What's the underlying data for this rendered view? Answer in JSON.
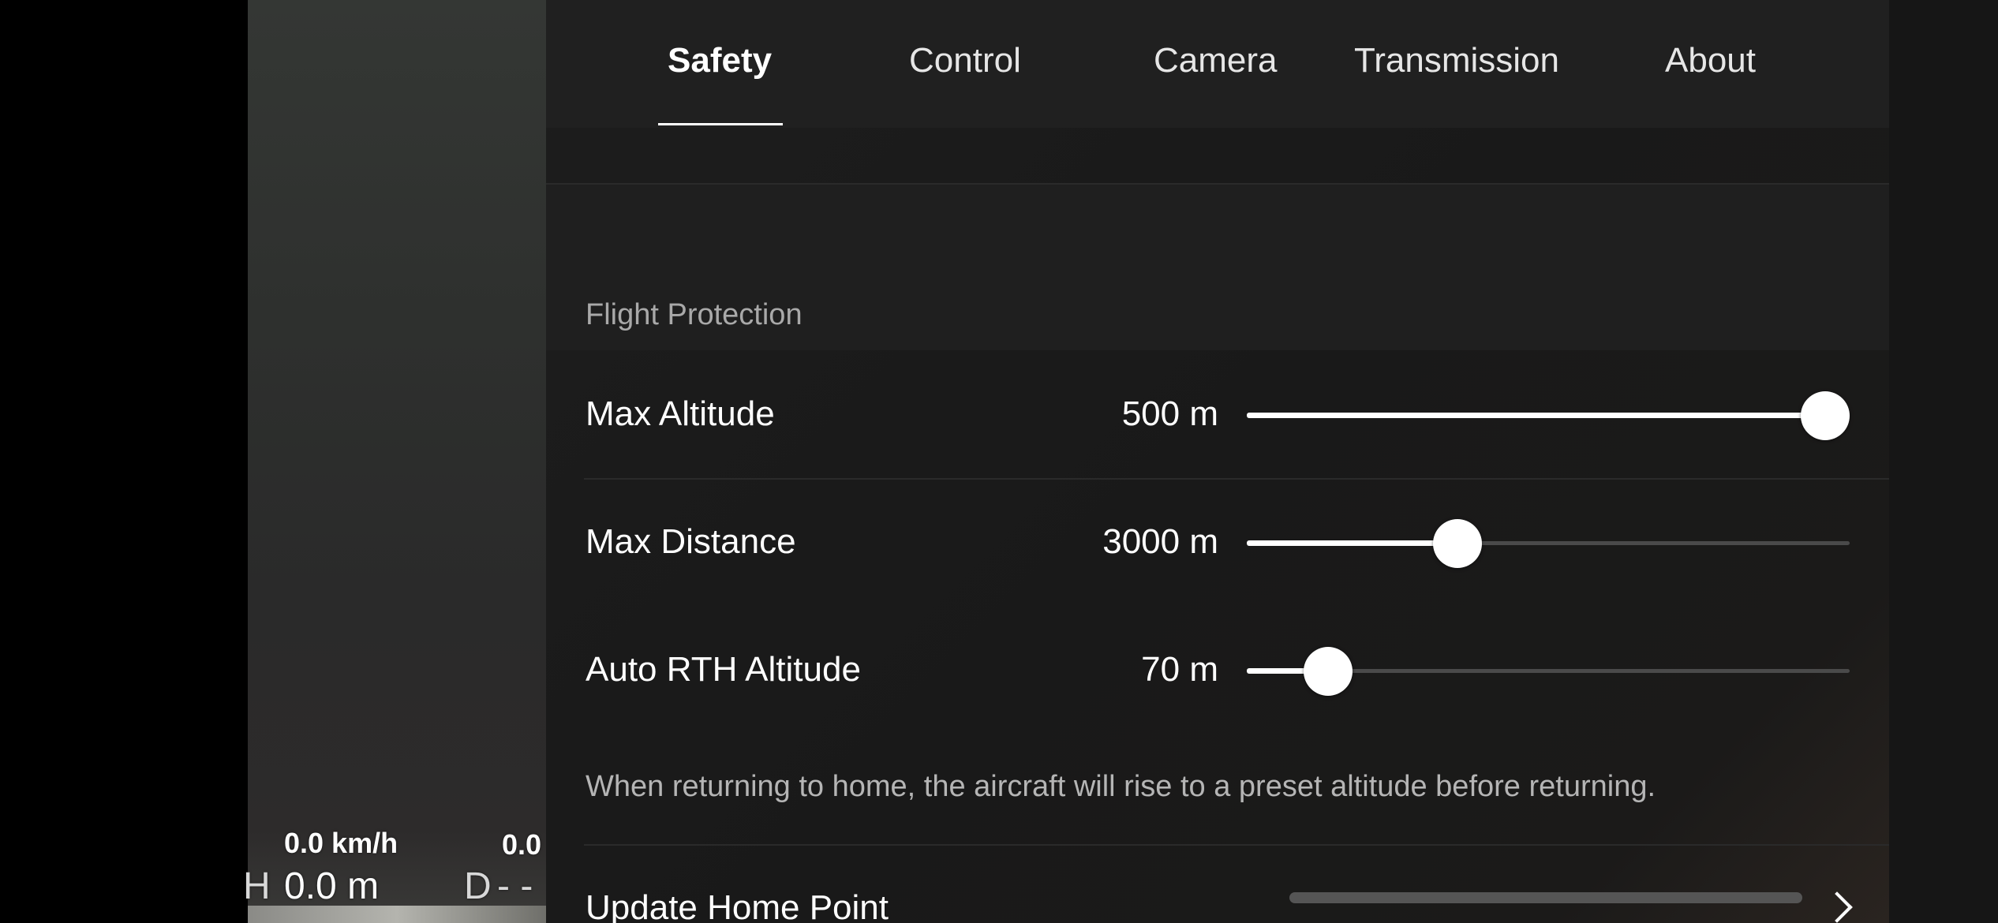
{
  "hud": {
    "speed_h": "0.0 km/h",
    "speed_v": "0.0",
    "height_prefix": "H",
    "height_value": "0.0 m",
    "distance_prefix": "D",
    "distance_value": "- -"
  },
  "tabs": [
    {
      "label": "Safety",
      "active": true
    },
    {
      "label": "Control",
      "active": false
    },
    {
      "label": "Camera",
      "active": false
    },
    {
      "label": "Transmission",
      "active": false
    },
    {
      "label": "About",
      "active": false
    }
  ],
  "section": {
    "title": "Flight Protection"
  },
  "settings": [
    {
      "label": "Max Altitude",
      "value": "500 m",
      "level": 0.96
    },
    {
      "label": "Max Distance",
      "value": "3000 m",
      "level": 0.35
    },
    {
      "label": "Auto RTH Altitude",
      "value": "70 m",
      "level": 0.135
    }
  ],
  "hint": "When returning to home, the aircraft will rise to a preset altitude before returning.",
  "nav": {
    "update_home_point": "Update Home Point"
  },
  "colors": {
    "panel_bg": "#1b1b1b",
    "accent": "#ffffff",
    "track": "#4a4a4a"
  }
}
